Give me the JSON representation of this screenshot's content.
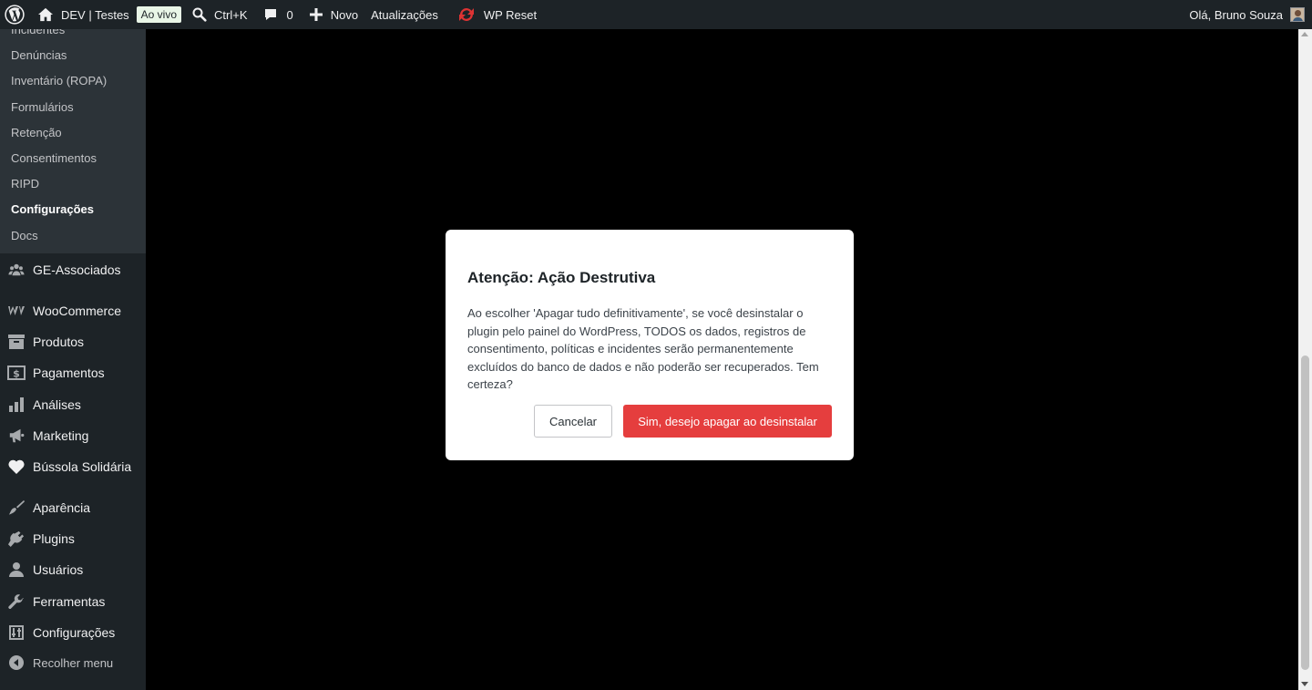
{
  "adminbar": {
    "site_name": "DEV | Testes",
    "live_badge": "Ao vivo",
    "search_shortcut": "Ctrl+K",
    "comments_count": "0",
    "new_label": "Novo",
    "updates_label": "Atualizações",
    "wp_reset_label": "WP Reset",
    "greeting": "Olá, Bruno Souza"
  },
  "sidebar": {
    "submenu": [
      {
        "label": "Incidentes"
      },
      {
        "label": "Denúncias"
      },
      {
        "label": "Inventário (ROPA)"
      },
      {
        "label": "Formulários"
      },
      {
        "label": "Retenção"
      },
      {
        "label": "Consentimentos"
      },
      {
        "label": "RIPD"
      },
      {
        "label": "Configurações",
        "current": true
      },
      {
        "label": "Docs"
      }
    ],
    "menu": [
      {
        "label": "GE-Associados",
        "icon": "groups-icon"
      },
      {
        "label": "WooCommerce",
        "icon": "woocommerce-icon"
      },
      {
        "label": "Produtos",
        "icon": "archive-icon"
      },
      {
        "label": "Pagamentos",
        "icon": "payments-icon"
      },
      {
        "label": "Análises",
        "icon": "chart-bar-icon"
      },
      {
        "label": "Marketing",
        "icon": "megaphone-icon"
      },
      {
        "label": "Bússola Solidária",
        "icon": "heart-icon"
      },
      {
        "label": "Aparência",
        "icon": "paintbrush-icon"
      },
      {
        "label": "Plugins",
        "icon": "plugin-icon"
      },
      {
        "label": "Usuários",
        "icon": "user-icon"
      },
      {
        "label": "Ferramentas",
        "icon": "wrench-icon"
      },
      {
        "label": "Configurações",
        "icon": "settings-sliders-icon"
      }
    ],
    "collapse_label": "Recolher menu"
  },
  "modal": {
    "title": "Atenção: Ação Destrutiva",
    "body": "Ao escolher 'Apagar tudo definitivamente', se você desinstalar o plugin pelo painel do WordPress, TODOS os dados, registros de consentimento, políticas e incidentes serão permanentemente excluídos do banco de dados e não poderão ser recuperados. Tem certeza?",
    "cancel_label": "Cancelar",
    "confirm_label": "Sim, desejo apagar ao desinstalar"
  },
  "colors": {
    "adminbar_bg": "#1d2327",
    "sidebar_submenu_bg": "#2c3338",
    "live_badge_bg": "#e9f6e7",
    "danger_button": "#e53e3e",
    "overlay": "#000000"
  }
}
